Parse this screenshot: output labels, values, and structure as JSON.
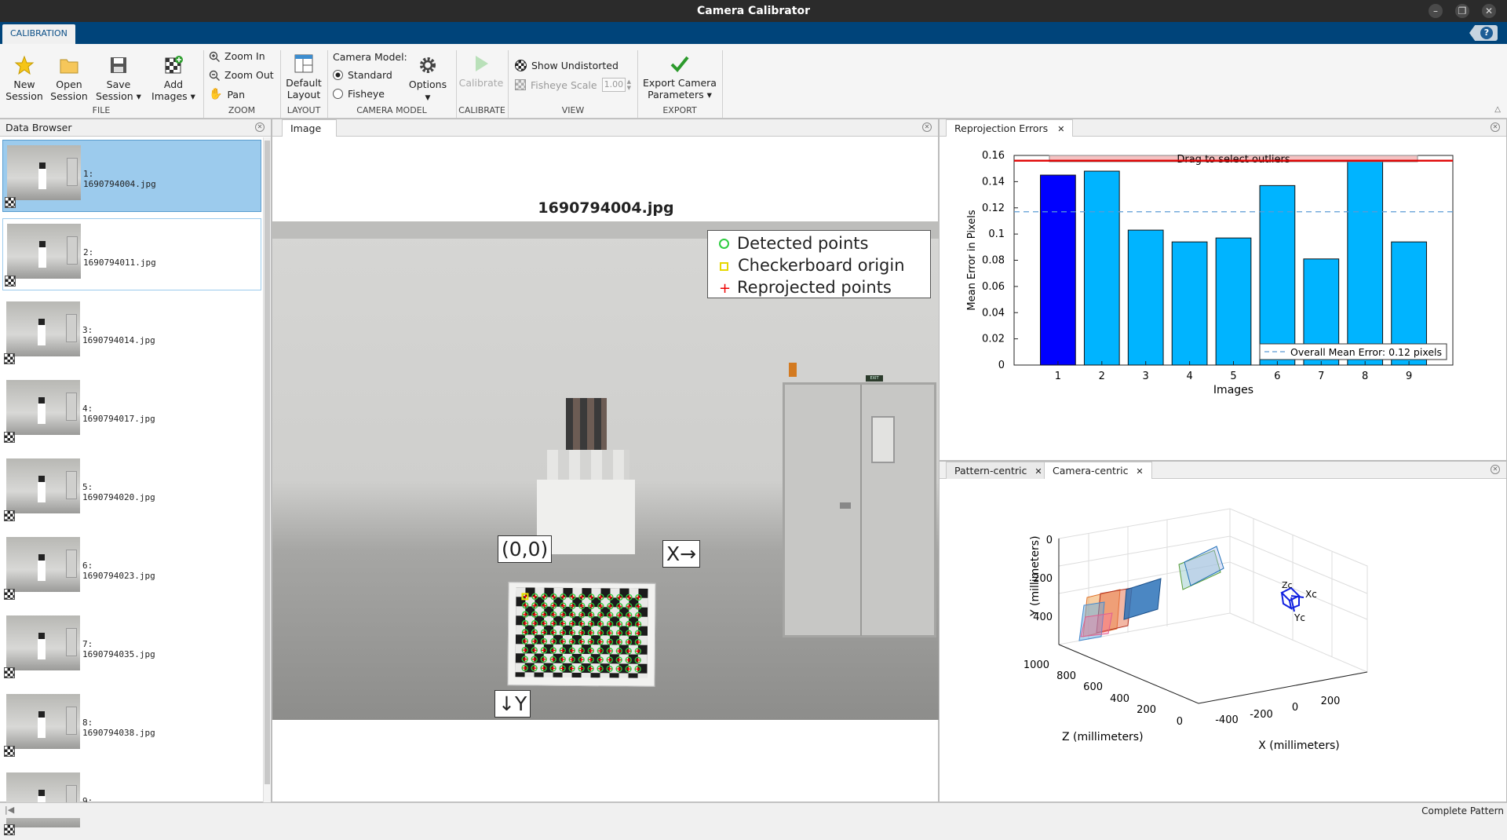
{
  "window": {
    "title": "Camera Calibrator"
  },
  "toolstrip_tab": "CALIBRATION",
  "help_label": "?",
  "ribbon": {
    "new_session": [
      "New",
      "Session"
    ],
    "open_session": [
      "Open",
      "Session"
    ],
    "save_session": [
      "Save",
      "Session ▾"
    ],
    "add_images": [
      "Add",
      "Images ▾"
    ],
    "zoom_in": "Zoom In",
    "zoom_out": "Zoom Out",
    "pan": "Pan",
    "default_layout": [
      "Default",
      "Layout"
    ],
    "camera_model_label": "Camera Model:",
    "standard": "Standard",
    "fisheye": "Fisheye",
    "options": "Options",
    "calibrate": "Calibrate",
    "show_undistorted": "Show Undistorted",
    "fisheye_scale": "Fisheye Scale",
    "fisheye_scale_value": "1.00",
    "export": [
      "Export Camera",
      "Parameters ▾"
    ],
    "groups": {
      "file": "FILE",
      "zoom": "ZOOM",
      "layout": "LAYOUT",
      "camera_model": "CAMERA MODEL",
      "calibrate": "CALIBRATE",
      "view": "VIEW",
      "export": "EXPORT"
    }
  },
  "data_browser": {
    "title": "Data Browser",
    "items": [
      {
        "index": "1:",
        "file": "1690794004.jpg"
      },
      {
        "index": "2:",
        "file": "1690794011.jpg"
      },
      {
        "index": "3:",
        "file": "1690794014.jpg"
      },
      {
        "index": "4:",
        "file": "1690794017.jpg"
      },
      {
        "index": "5:",
        "file": "1690794020.jpg"
      },
      {
        "index": "6:",
        "file": "1690794023.jpg"
      },
      {
        "index": "7:",
        "file": "1690794035.jpg"
      },
      {
        "index": "8:",
        "file": "1690794038.jpg"
      },
      {
        "index": "9:",
        "file": ""
      }
    ]
  },
  "image_panel": {
    "tab": "Image",
    "title": "1690794004.jpg",
    "legend": [
      "Detected points",
      "Checkerboard origin",
      "Reprojected points"
    ],
    "origin_label": "(0,0)",
    "x_label": "X→",
    "y_label": "↓Y",
    "exit_sign": "EXIT"
  },
  "reprojection": {
    "tab": "Reprojection Errors",
    "drag_label": "Drag to select outliers",
    "chart_data": {
      "type": "bar",
      "categories": [
        "1",
        "2",
        "3",
        "4",
        "5",
        "6",
        "7",
        "8",
        "9"
      ],
      "values": [
        0.145,
        0.148,
        0.103,
        0.094,
        0.097,
        0.137,
        0.081,
        0.156,
        0.094
      ],
      "selected_index": 0,
      "mean": 0.117,
      "threshold": 0.156,
      "ylim": [
        0,
        0.16
      ],
      "yticks": [
        "0",
        "0.02",
        "0.04",
        "0.06",
        "0.08",
        "0.1",
        "0.12",
        "0.14",
        "0.16"
      ],
      "xlabel": "Images",
      "ylabel": "Mean Error in Pixels",
      "legend": "Overall Mean Error: 0.12 pixels",
      "colors": {
        "bar": "#00b4ff",
        "selected": "#0000ff",
        "threshold": "#e00000",
        "mean": "#5b9bd5"
      }
    }
  },
  "extrinsics": {
    "tabs": [
      "Pattern-centric",
      "Camera-centric"
    ],
    "active_tab": "Camera-centric",
    "y_axis_label": "Y (millimeters)",
    "z_axis_label": "Z (millimeters)",
    "x_axis_label": "X (millimeters)",
    "y_ticks": [
      "0",
      "200",
      "400"
    ],
    "z_ticks": [
      "1000",
      "800",
      "600",
      "400",
      "200",
      "0"
    ],
    "x_ticks": [
      "-400",
      "-200",
      "0",
      "200"
    ],
    "camera_labels": [
      "Zc",
      "Xc",
      "Yc"
    ]
  },
  "status": {
    "text": "Complete Pattern"
  }
}
